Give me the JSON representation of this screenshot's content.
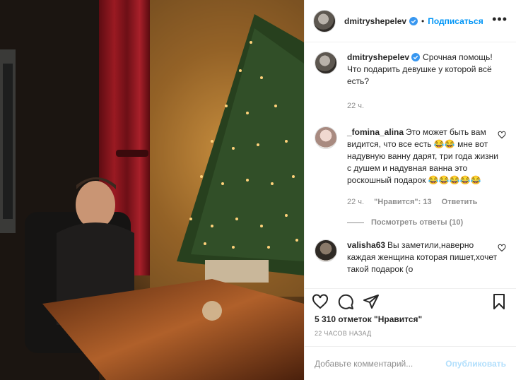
{
  "post": {
    "author": "dmitryshepelev",
    "follow_label": "Подписаться",
    "more_label": "•••",
    "caption_text": "Срочная помощь! Что подарить девушке у которой всё есть?",
    "caption_time": "22 ч."
  },
  "comments": [
    {
      "user": "_fomina_alina",
      "text": "Это может быть вам видится, что все есть 😂😂 мне вот надувную ванну дарят, три года жизни с душем и надувная ванна это роскошный подарок 😂😂😂😂😂",
      "time": "22 ч.",
      "likes": "\"Нравится\": 13",
      "reply": "Ответить",
      "view_replies": "Посмотреть ответы (10)"
    },
    {
      "user": "valisha63",
      "text": "Вы заметили,наверно каждая женщина которая пишет,хочет такой подарок (о"
    }
  ],
  "stats": {
    "likes_label": "5 310 отметок \"Нравится\"",
    "timestamp": "22 ЧАСОВ НАЗАД"
  },
  "add_comment": {
    "placeholder": "Добавьте комментарий...",
    "publish_label": "Опубликовать"
  },
  "colors": {
    "link": "#0095f6",
    "muted": "#8e8e8e",
    "publish_disabled": "#b2dffc"
  }
}
